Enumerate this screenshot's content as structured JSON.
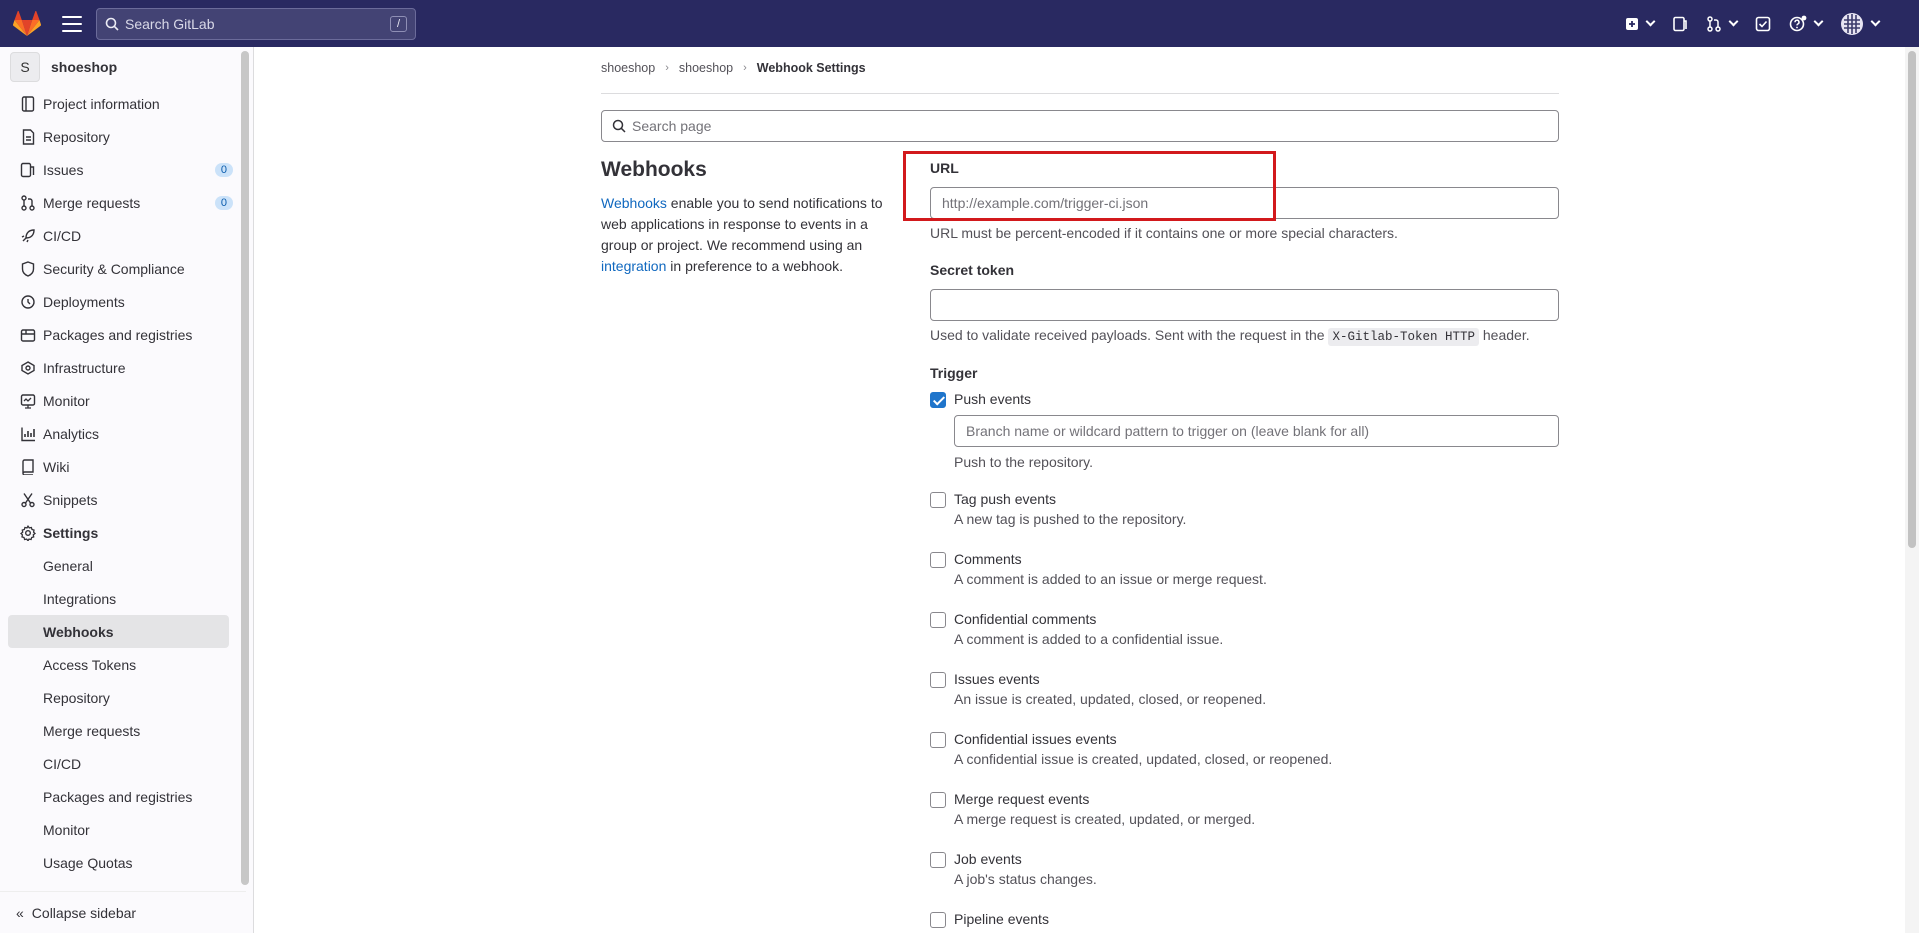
{
  "topbar": {
    "search_placeholder": "Search GitLab",
    "search_shortcut": "/"
  },
  "sidebar": {
    "project_initial": "S",
    "project_name": "shoeshop",
    "items": [
      {
        "label": "Project information",
        "icon": "info-icon"
      },
      {
        "label": "Repository",
        "icon": "doc-icon"
      },
      {
        "label": "Issues",
        "icon": "issues-icon",
        "badge": "0"
      },
      {
        "label": "Merge requests",
        "icon": "merge-request-icon",
        "badge": "0"
      },
      {
        "label": "CI/CD",
        "icon": "rocket-icon"
      },
      {
        "label": "Security & Compliance",
        "icon": "shield-icon"
      },
      {
        "label": "Deployments",
        "icon": "deployments-icon"
      },
      {
        "label": "Packages and registries",
        "icon": "package-icon"
      },
      {
        "label": "Infrastructure",
        "icon": "cloud-icon"
      },
      {
        "label": "Monitor",
        "icon": "monitor-icon"
      },
      {
        "label": "Analytics",
        "icon": "chart-icon"
      },
      {
        "label": "Wiki",
        "icon": "book-icon"
      },
      {
        "label": "Snippets",
        "icon": "scissors-icon"
      },
      {
        "label": "Settings",
        "icon": "gear-icon"
      }
    ],
    "settings_sub": [
      "General",
      "Integrations",
      "Webhooks",
      "Access Tokens",
      "Repository",
      "Merge requests",
      "CI/CD",
      "Packages and registries",
      "Monitor",
      "Usage Quotas"
    ],
    "collapse_label": "Collapse sidebar"
  },
  "breadcrumb": [
    "shoeshop",
    "shoeshop",
    "Webhook Settings"
  ],
  "page_search_placeholder": "Search page",
  "webhooks": {
    "title": "Webhooks",
    "desc_link1": "Webhooks",
    "desc_text1": " enable you to send notifications to web applications in response to events in a group or project. We recommend using an ",
    "desc_link2": "integration",
    "desc_text2": " in preference to a webhook."
  },
  "form": {
    "url_label": "URL",
    "url_placeholder": "http://example.com/trigger-ci.json",
    "url_help": "URL must be percent-encoded if it contains one or more special characters.",
    "token_label": "Secret token",
    "token_help_1": "Used to validate received payloads. Sent with the request in the ",
    "token_help_code": "X-Gitlab-Token HTTP",
    "token_help_2": " header.",
    "trigger_label": "Trigger",
    "branch_placeholder": "Branch name or wildcard pattern to trigger on (leave blank for all)",
    "push_help": "Push to the repository.",
    "events": [
      {
        "title": "Push events",
        "desc": "",
        "checked": true
      },
      {
        "title": "Tag push events",
        "desc": "A new tag is pushed to the repository.",
        "checked": false
      },
      {
        "title": "Comments",
        "desc": "A comment is added to an issue or merge request.",
        "checked": false
      },
      {
        "title": "Confidential comments",
        "desc": "A comment is added to a confidential issue.",
        "checked": false
      },
      {
        "title": "Issues events",
        "desc": "An issue is created, updated, closed, or reopened.",
        "checked": false
      },
      {
        "title": "Confidential issues events",
        "desc": "A confidential issue is created, updated, closed, or reopened.",
        "checked": false
      },
      {
        "title": "Merge request events",
        "desc": "A merge request is created, updated, or merged.",
        "checked": false
      },
      {
        "title": "Job events",
        "desc": "A job's status changes.",
        "checked": false
      },
      {
        "title": "Pipeline events",
        "desc": "",
        "checked": false
      }
    ]
  }
}
